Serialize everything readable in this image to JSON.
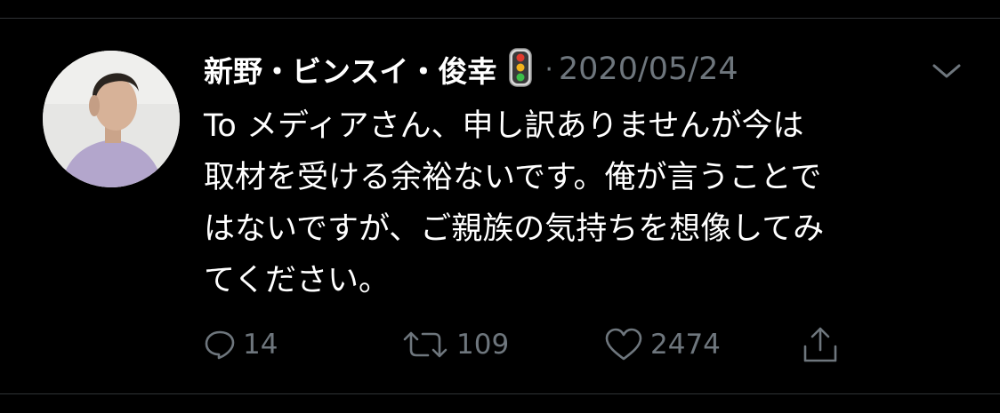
{
  "tweet": {
    "author_name": "新野・ビンスイ・俊幸",
    "separator": "·",
    "date": "2020/05/24",
    "text_lines": [
      "To メディアさん、申し訳ありませんが今は",
      "取材を受ける余裕ないです。俺が言うことで",
      "はないですが、ご親族の気持ちを想像してみ",
      "てください。"
    ]
  },
  "actions": {
    "reply_count": "14",
    "retweet_count": "109",
    "like_count": "2474"
  },
  "colors": {
    "background": "#000000",
    "text_primary": "#ffffff",
    "text_secondary": "#6e767d",
    "divider": "#2f3336"
  },
  "icons": {
    "emoji": "traffic-light-icon",
    "menu": "chevron-down-icon",
    "reply": "reply-icon",
    "retweet": "retweet-icon",
    "like": "heart-icon",
    "share": "share-icon"
  }
}
